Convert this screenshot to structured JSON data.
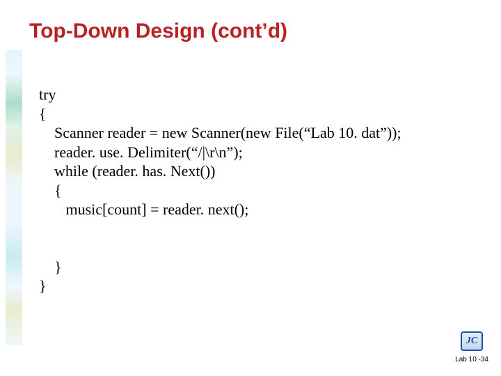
{
  "slide": {
    "title": "Top-Down Design (cont’d)",
    "code": {
      "l1": "try",
      "l2": "{",
      "l3": "    Scanner reader = new Scanner(new File(“Lab 10. dat”));",
      "l4": "    reader. use. Delimiter(“/|\\r\\n”);",
      "l5": "    while (reader. has. Next())",
      "l6": "    {",
      "l7": "       music[count] = reader. next();",
      "l8": "",
      "l9": "",
      "l10": "    }",
      "l11": "}"
    },
    "footer": {
      "logo_text": "JC",
      "label": "Lab 10 -34"
    }
  }
}
